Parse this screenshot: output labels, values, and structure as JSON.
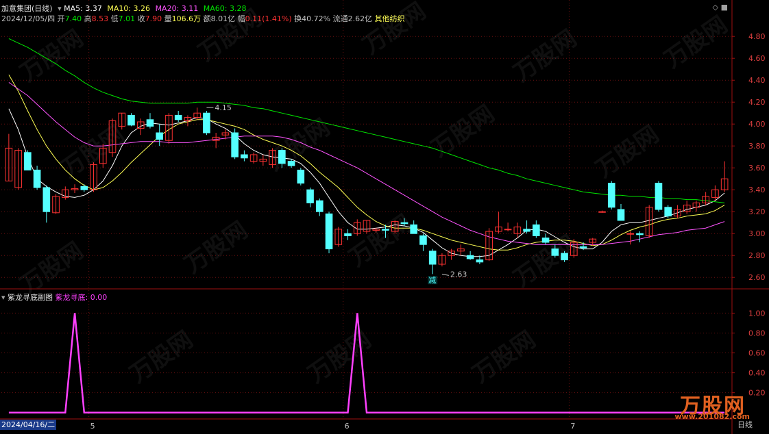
{
  "header": {
    "title": "加意集团(日线)",
    "ma5": "MA5: 3.37",
    "ma10": "MA10: 3.26",
    "ma20": "MA20: 3.11",
    "ma60": "MA60: 3.28",
    "date": "2024/12/05/四",
    "open_label": "开",
    "open": "7.40",
    "high_label": "高",
    "high": "8.53",
    "low_label": "低",
    "low": "7.01",
    "close_label": "收",
    "close": "7.90",
    "vol_label": "量",
    "vol": "106.6万",
    "amt_label": "额",
    "amt": "8.01亿",
    "chg_label": "幅",
    "chg": "0.11(1.41%)",
    "turn_label": "换",
    "turn": "40.72%",
    "float_label": "流通",
    "float": "2.62亿",
    "industry": "其他纺织"
  },
  "sub_header": {
    "title": "紫龙寻底副图",
    "indicator": "紫龙寻底: 0.00"
  },
  "colors": {
    "up": "#ff3232",
    "down": "#54ffff",
    "ma5": "#ffffff",
    "ma10": "#ffff54",
    "ma20": "#ff54ff",
    "ma60": "#00e600",
    "indicator": "#ff40ff",
    "axis": "#a01010"
  },
  "corner_date": "2024/04/16/二",
  "period_label": "日线",
  "logo_text": "万股网",
  "logo_url": "www.201082.com",
  "watermark": "万股网",
  "chart_data": [
    {
      "type": "candlestick",
      "title": "加意集团(日线)",
      "ylim": [
        2.52,
        4.92
      ],
      "y_ticks": [
        2.6,
        2.8,
        3.0,
        3.2,
        3.4,
        3.6,
        3.8,
        4.0,
        4.2,
        4.4,
        4.6,
        4.8
      ],
      "x_labels": [
        "5",
        "6",
        "7"
      ],
      "annotations": [
        {
          "text": "4.15",
          "x": 21,
          "y": 4.15
        },
        {
          "text": "2.63",
          "x": 46,
          "y": 2.63
        },
        {
          "text": "减",
          "x": 45,
          "y": 2.55
        }
      ],
      "candles": [
        {
          "o": 3.48,
          "h": 3.91,
          "l": 3.48,
          "c": 3.78
        },
        {
          "o": 3.42,
          "h": 3.78,
          "l": 3.4,
          "c": 3.76
        },
        {
          "o": 3.74,
          "h": 3.76,
          "l": 3.58,
          "c": 3.58
        },
        {
          "o": 3.58,
          "h": 3.62,
          "l": 3.4,
          "c": 3.42
        },
        {
          "o": 3.42,
          "h": 3.44,
          "l": 3.1,
          "c": 3.2
        },
        {
          "o": 3.19,
          "h": 3.36,
          "l": 3.18,
          "c": 3.34
        },
        {
          "o": 3.33,
          "h": 3.43,
          "l": 3.31,
          "c": 3.4
        },
        {
          "o": 3.4,
          "h": 3.45,
          "l": 3.37,
          "c": 3.41
        },
        {
          "o": 3.43,
          "h": 3.45,
          "l": 3.38,
          "c": 3.4
        },
        {
          "o": 3.4,
          "h": 3.65,
          "l": 3.38,
          "c": 3.63
        },
        {
          "o": 3.64,
          "h": 3.82,
          "l": 3.6,
          "c": 3.78
        },
        {
          "o": 3.74,
          "h": 4.05,
          "l": 3.7,
          "c": 4.03
        },
        {
          "o": 3.98,
          "h": 4.1,
          "l": 3.95,
          "c": 4.1
        },
        {
          "o": 4.08,
          "h": 4.1,
          "l": 3.98,
          "c": 3.99
        },
        {
          "o": 3.96,
          "h": 4.05,
          "l": 3.9,
          "c": 4.02
        },
        {
          "o": 4.04,
          "h": 4.1,
          "l": 3.96,
          "c": 3.98
        },
        {
          "o": 3.92,
          "h": 4.0,
          "l": 3.8,
          "c": 3.86
        },
        {
          "o": 3.85,
          "h": 4.1,
          "l": 3.82,
          "c": 4.08
        },
        {
          "o": 4.08,
          "h": 4.12,
          "l": 4.02,
          "c": 4.04
        },
        {
          "o": 4.03,
          "h": 4.08,
          "l": 3.98,
          "c": 4.06
        },
        {
          "o": 4.06,
          "h": 4.15,
          "l": 4.04,
          "c": 4.1
        },
        {
          "o": 4.1,
          "h": 4.12,
          "l": 3.9,
          "c": 3.92
        },
        {
          "o": 3.85,
          "h": 3.92,
          "l": 3.78,
          "c": 3.88
        },
        {
          "o": 3.9,
          "h": 3.95,
          "l": 3.86,
          "c": 3.92
        },
        {
          "o": 3.92,
          "h": 3.96,
          "l": 3.68,
          "c": 3.7
        },
        {
          "o": 3.72,
          "h": 3.76,
          "l": 3.66,
          "c": 3.69
        },
        {
          "o": 3.66,
          "h": 3.74,
          "l": 3.64,
          "c": 3.72
        },
        {
          "o": 3.66,
          "h": 3.72,
          "l": 3.62,
          "c": 3.68
        },
        {
          "o": 3.63,
          "h": 3.78,
          "l": 3.6,
          "c": 3.76
        },
        {
          "o": 3.76,
          "h": 3.78,
          "l": 3.6,
          "c": 3.64
        },
        {
          "o": 3.66,
          "h": 3.68,
          "l": 3.6,
          "c": 3.62
        },
        {
          "o": 3.58,
          "h": 3.6,
          "l": 3.44,
          "c": 3.46
        },
        {
          "o": 3.4,
          "h": 3.42,
          "l": 3.24,
          "c": 3.28
        },
        {
          "o": 3.3,
          "h": 3.32,
          "l": 3.16,
          "c": 3.2
        },
        {
          "o": 3.18,
          "h": 3.2,
          "l": 2.82,
          "c": 2.86
        },
        {
          "o": 2.9,
          "h": 3.06,
          "l": 2.88,
          "c": 3.04
        },
        {
          "o": 3.0,
          "h": 3.04,
          "l": 2.94,
          "c": 2.98
        },
        {
          "o": 3.0,
          "h": 3.13,
          "l": 2.98,
          "c": 3.1
        },
        {
          "o": 3.02,
          "h": 3.12,
          "l": 3.0,
          "c": 3.12
        },
        {
          "o": 3.03,
          "h": 3.05,
          "l": 3.01,
          "c": 3.04
        },
        {
          "o": 3.04,
          "h": 3.08,
          "l": 2.96,
          "c": 3.03
        },
        {
          "o": 3.02,
          "h": 3.12,
          "l": 3.0,
          "c": 3.11
        },
        {
          "o": 3.1,
          "h": 3.14,
          "l": 3.07,
          "c": 3.09
        },
        {
          "o": 3.08,
          "h": 3.12,
          "l": 3.0,
          "c": 3.0
        },
        {
          "o": 2.98,
          "h": 3.0,
          "l": 2.84,
          "c": 2.9
        },
        {
          "o": 2.84,
          "h": 2.86,
          "l": 2.63,
          "c": 2.72
        },
        {
          "o": 2.72,
          "h": 2.82,
          "l": 2.7,
          "c": 2.8
        },
        {
          "o": 2.8,
          "h": 2.86,
          "l": 2.76,
          "c": 2.84
        },
        {
          "o": 2.84,
          "h": 2.9,
          "l": 2.8,
          "c": 2.86
        },
        {
          "o": 2.8,
          "h": 2.84,
          "l": 2.76,
          "c": 2.77
        },
        {
          "o": 2.76,
          "h": 2.8,
          "l": 2.72,
          "c": 2.74
        },
        {
          "o": 2.76,
          "h": 3.05,
          "l": 2.75,
          "c": 3.02
        },
        {
          "o": 3.02,
          "h": 3.2,
          "l": 3.0,
          "c": 3.06
        },
        {
          "o": 3.04,
          "h": 3.1,
          "l": 3.02,
          "c": 3.04
        },
        {
          "o": 3.0,
          "h": 3.1,
          "l": 2.96,
          "c": 3.06
        },
        {
          "o": 3.04,
          "h": 3.12,
          "l": 3.0,
          "c": 3.02
        },
        {
          "o": 3.08,
          "h": 3.12,
          "l": 2.96,
          "c": 2.98
        },
        {
          "o": 2.96,
          "h": 3.0,
          "l": 2.9,
          "c": 2.92
        },
        {
          "o": 2.86,
          "h": 2.9,
          "l": 2.78,
          "c": 2.8
        },
        {
          "o": 2.82,
          "h": 2.84,
          "l": 2.74,
          "c": 2.76
        },
        {
          "o": 2.8,
          "h": 2.95,
          "l": 2.78,
          "c": 2.92
        },
        {
          "o": 2.88,
          "h": 2.92,
          "l": 2.85,
          "c": 2.87
        },
        {
          "o": 2.92,
          "h": 2.96,
          "l": 2.89,
          "c": 2.95
        },
        {
          "o": 3.2,
          "h": 3.21,
          "l": 3.19,
          "c": 3.2
        },
        {
          "o": 3.46,
          "h": 3.48,
          "l": 3.22,
          "c": 3.24
        },
        {
          "o": 3.22,
          "h": 3.27,
          "l": 3.12,
          "c": 3.12
        },
        {
          "o": 3.0,
          "h": 3.02,
          "l": 2.9,
          "c": 3.0
        },
        {
          "o": 3.0,
          "h": 3.02,
          "l": 2.92,
          "c": 2.99
        },
        {
          "o": 2.98,
          "h": 3.26,
          "l": 2.96,
          "c": 3.24
        },
        {
          "o": 3.46,
          "h": 3.48,
          "l": 3.2,
          "c": 3.22
        },
        {
          "o": 3.24,
          "h": 3.26,
          "l": 3.14,
          "c": 3.16
        },
        {
          "o": 3.16,
          "h": 3.26,
          "l": 3.14,
          "c": 3.22
        },
        {
          "o": 3.2,
          "h": 3.3,
          "l": 3.18,
          "c": 3.26
        },
        {
          "o": 3.24,
          "h": 3.3,
          "l": 3.2,
          "c": 3.28
        },
        {
          "o": 3.28,
          "h": 3.38,
          "l": 3.26,
          "c": 3.34
        },
        {
          "o": 3.33,
          "h": 3.44,
          "l": 3.3,
          "c": 3.4
        },
        {
          "o": 3.4,
          "h": 3.66,
          "l": 3.38,
          "c": 3.5
        }
      ],
      "series": [
        {
          "name": "MA5",
          "values": [
            4.14,
            3.95,
            3.7,
            3.5,
            3.43,
            3.38,
            3.34,
            3.33,
            3.35,
            3.4,
            3.48,
            3.62,
            3.8,
            3.92,
            3.98,
            4.01,
            4.0,
            3.99,
            4.01,
            4.03,
            4.06,
            4.05,
            4.0,
            3.96,
            3.9,
            3.82,
            3.76,
            3.72,
            3.7,
            3.69,
            3.68,
            3.64,
            3.56,
            3.46,
            3.33,
            3.2,
            3.1,
            3.04,
            3.04,
            3.05,
            3.06,
            3.08,
            3.07,
            3.05,
            3.01,
            2.94,
            2.87,
            2.82,
            2.8,
            2.79,
            2.79,
            2.8,
            2.85,
            2.9,
            2.96,
            3.03,
            3.04,
            3.02,
            2.97,
            2.92,
            2.88,
            2.86,
            2.86,
            2.92,
            3.02,
            3.08,
            3.1,
            3.1,
            3.12,
            3.14,
            3.16,
            3.19,
            3.22,
            3.24,
            3.26,
            3.3,
            3.37
          ]
        },
        {
          "name": "MA10",
          "values": [
            4.45,
            4.3,
            4.12,
            3.95,
            3.8,
            3.68,
            3.58,
            3.5,
            3.44,
            3.4,
            3.42,
            3.48,
            3.56,
            3.65,
            3.73,
            3.81,
            3.89,
            3.95,
            4.0,
            4.02,
            4.04,
            4.04,
            4.02,
            4.0,
            3.98,
            3.95,
            3.9,
            3.86,
            3.83,
            3.8,
            3.76,
            3.71,
            3.64,
            3.56,
            3.49,
            3.42,
            3.33,
            3.24,
            3.17,
            3.11,
            3.07,
            3.05,
            3.05,
            3.05,
            3.03,
            3.0,
            2.97,
            2.94,
            2.92,
            2.9,
            2.88,
            2.86,
            2.85,
            2.85,
            2.87,
            2.9,
            2.92,
            2.93,
            2.94,
            2.94,
            2.93,
            2.91,
            2.89,
            2.9,
            2.94,
            2.99,
            3.03,
            3.06,
            3.08,
            3.11,
            3.13,
            3.14,
            3.16,
            3.17,
            3.18,
            3.21,
            3.26
          ]
        },
        {
          "name": "MA20",
          "values": [
            4.38,
            4.32,
            4.26,
            4.18,
            4.1,
            4.02,
            3.95,
            3.88,
            3.83,
            3.8,
            3.8,
            3.81,
            3.82,
            3.83,
            3.84,
            3.84,
            3.84,
            3.83,
            3.83,
            3.83,
            3.84,
            3.85,
            3.86,
            3.87,
            3.88,
            3.89,
            3.89,
            3.89,
            3.89,
            3.88,
            3.86,
            3.83,
            3.79,
            3.76,
            3.72,
            3.68,
            3.64,
            3.6,
            3.55,
            3.5,
            3.45,
            3.4,
            3.35,
            3.3,
            3.25,
            3.2,
            3.15,
            3.11,
            3.07,
            3.03,
            3.0,
            2.97,
            2.95,
            2.93,
            2.92,
            2.91,
            2.9,
            2.9,
            2.9,
            2.9,
            2.9,
            2.9,
            2.9,
            2.9,
            2.91,
            2.92,
            2.93,
            2.95,
            2.97,
            2.99,
            3.0,
            3.01,
            3.03,
            3.04,
            3.05,
            3.08,
            3.11
          ]
        },
        {
          "name": "MA60",
          "values": [
            4.78,
            4.74,
            4.7,
            4.65,
            4.6,
            4.55,
            4.49,
            4.44,
            4.38,
            4.33,
            4.29,
            4.26,
            4.23,
            4.21,
            4.2,
            4.19,
            4.19,
            4.19,
            4.19,
            4.19,
            4.2,
            4.2,
            4.2,
            4.19,
            4.18,
            4.17,
            4.15,
            4.14,
            4.12,
            4.1,
            4.08,
            4.06,
            4.04,
            4.02,
            4.0,
            3.98,
            3.96,
            3.94,
            3.92,
            3.9,
            3.88,
            3.86,
            3.84,
            3.82,
            3.8,
            3.78,
            3.75,
            3.72,
            3.69,
            3.66,
            3.63,
            3.6,
            3.58,
            3.55,
            3.53,
            3.5,
            3.48,
            3.46,
            3.44,
            3.42,
            3.4,
            3.38,
            3.37,
            3.36,
            3.35,
            3.35,
            3.34,
            3.34,
            3.33,
            3.33,
            3.32,
            3.32,
            3.31,
            3.31,
            3.3,
            3.29,
            3.28
          ]
        }
      ]
    },
    {
      "type": "line",
      "title": "紫龙寻底副图",
      "ylim": [
        -0.05,
        1.12
      ],
      "y_ticks": [
        0.2,
        0.4,
        0.6,
        0.8,
        1.0
      ],
      "series": [
        {
          "name": "紫龙寻底",
          "values": [
            0,
            0,
            0,
            0,
            0,
            0,
            0,
            1,
            0,
            0,
            0,
            0,
            0,
            0,
            0,
            0,
            0,
            0,
            0,
            0,
            0,
            0,
            0,
            0,
            0,
            0,
            0,
            0,
            0,
            0,
            0,
            0,
            0,
            0,
            0,
            0,
            0,
            1,
            0,
            0,
            0,
            0,
            0,
            0,
            0,
            0,
            0,
            0,
            0,
            0,
            0,
            0,
            0,
            0,
            0,
            0,
            0,
            0,
            0,
            0,
            0,
            0,
            0,
            0,
            0,
            0,
            0,
            0,
            0,
            0,
            0,
            0,
            0,
            0,
            0,
            0,
            0
          ]
        }
      ]
    }
  ]
}
